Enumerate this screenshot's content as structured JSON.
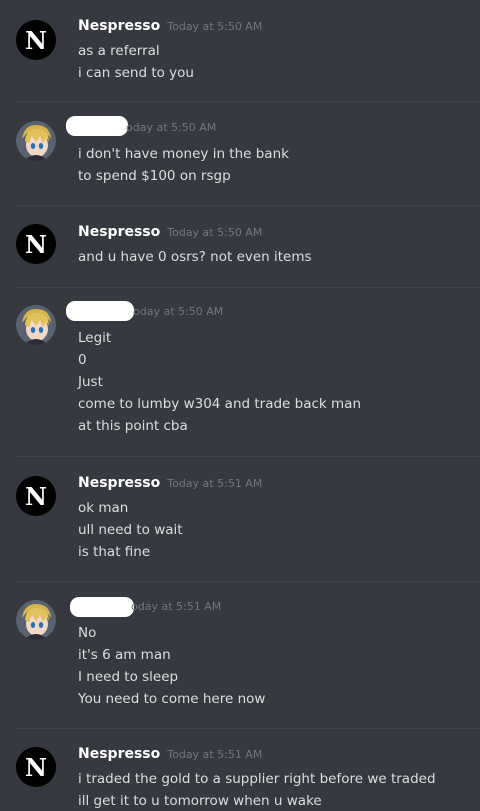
{
  "messages": [
    {
      "author": "Nespresso",
      "timestamp": "Today at 5:50 AM",
      "lines": [
        "as a referral",
        "i can send to you"
      ]
    },
    {
      "author": "",
      "timestamp": "oday at 5:50 AM",
      "lines": [
        "i don't have money in the bank",
        "to spend $100 on rsgp"
      ]
    },
    {
      "author": "Nespresso",
      "timestamp": "Today at 5:50 AM",
      "lines": [
        "and u have 0 osrs? not even items"
      ]
    },
    {
      "author": "",
      "timestamp": "oday at 5:50 AM",
      "lines": [
        "Legit",
        "0",
        "Just",
        "come to lumby w304 and trade back man",
        "at this point cba"
      ]
    },
    {
      "author": "Nespresso",
      "timestamp": "Today at 5:51 AM",
      "lines": [
        "ok man",
        "ull need to wait",
        "is that fine"
      ]
    },
    {
      "author": "",
      "timestamp": "oday at 5:51 AM",
      "lines": [
        "No",
        "it's 6 am man",
        "I need to sleep",
        "You need to come here now"
      ]
    },
    {
      "author": "Nespresso",
      "timestamp": "Today at 5:51 AM",
      "lines": [
        "i traded the gold to a supplier right before we traded",
        "ill get it to u tomorrow when u wake"
      ]
    }
  ],
  "nespresso_logo": "N",
  "colors": {
    "background": "#36393f",
    "text": "#dcddde",
    "username": "#ffffff",
    "timestamp": "#72767d",
    "separator": "#42454a"
  }
}
